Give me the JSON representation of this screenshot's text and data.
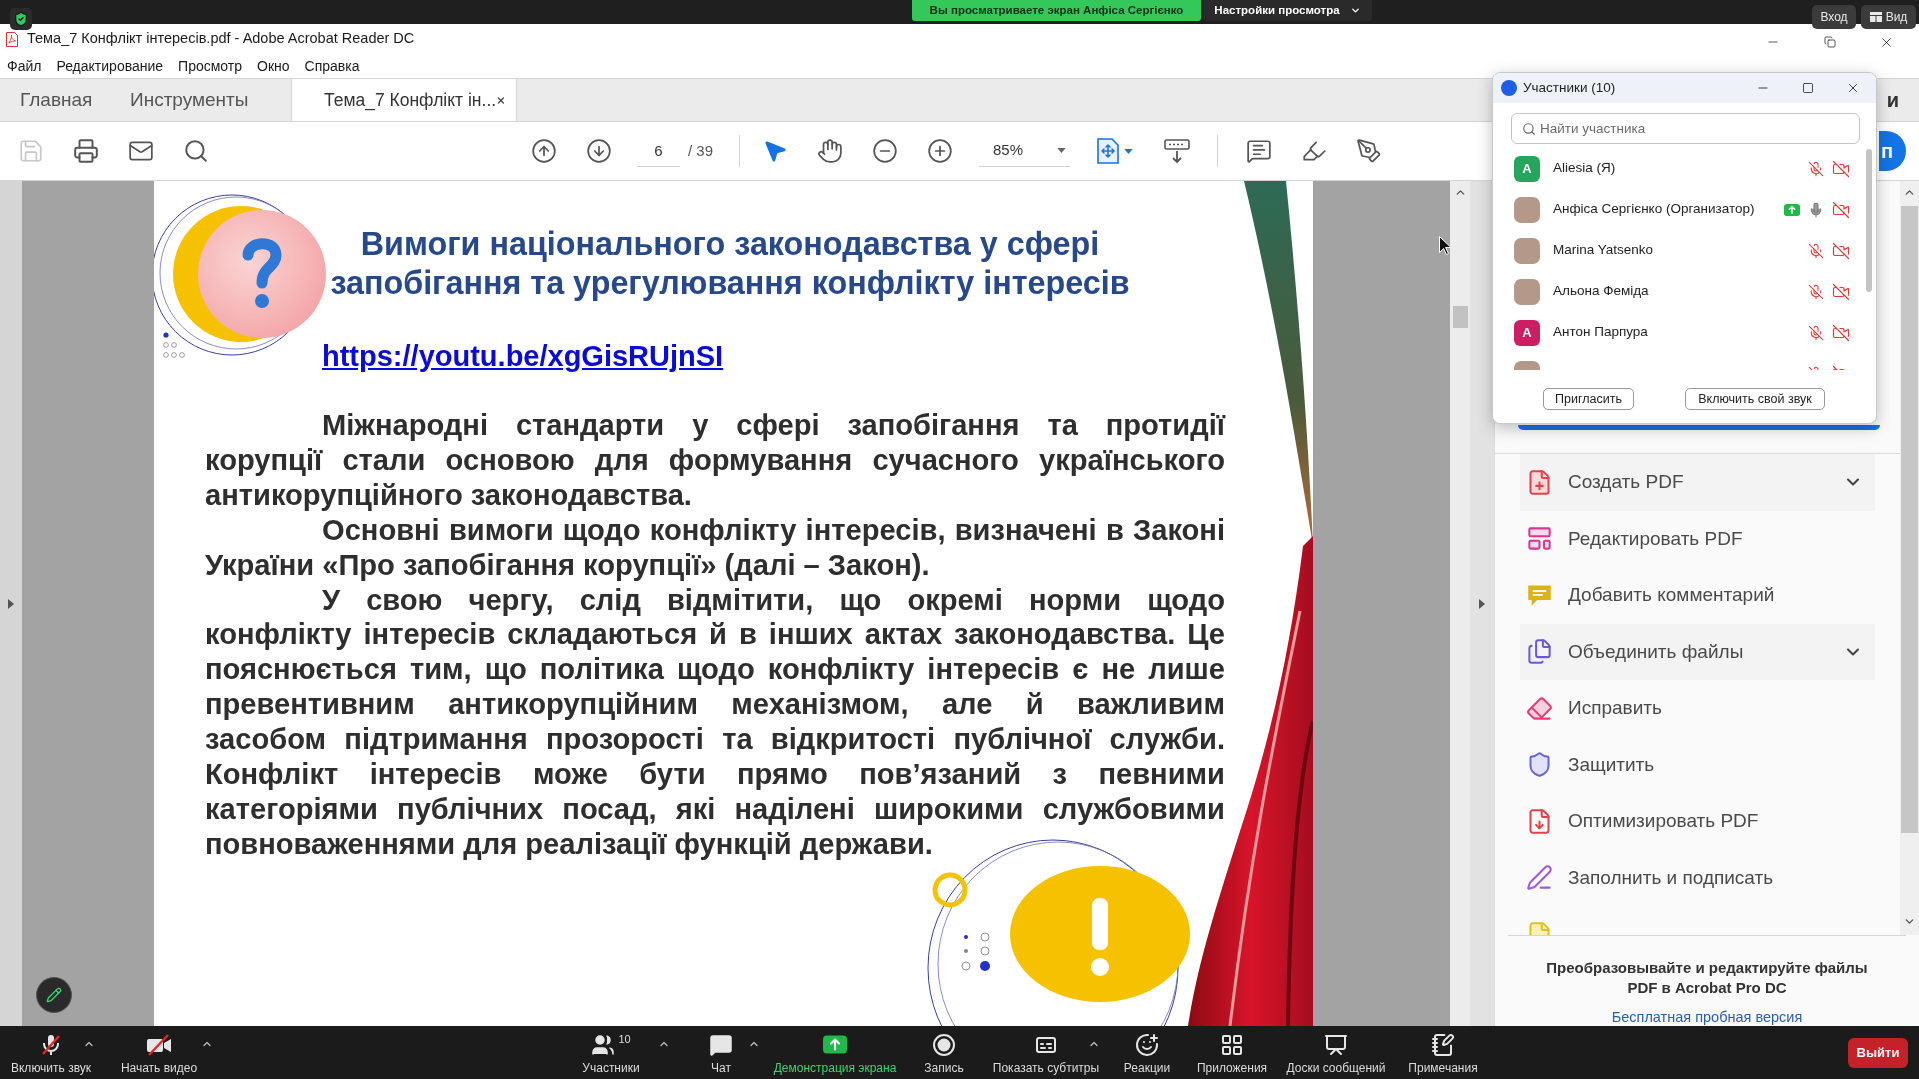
{
  "zoom_top_bar": {
    "viewing_banner": "Вы просматриваете экран Анфіса Сергієнко",
    "view_options": "Настройки просмотра",
    "sign_in": "Вход",
    "view": "Вид"
  },
  "window": {
    "title": "Тема_7 Конфлікт інтересів.pdf - Adobe Acrobat Reader DC"
  },
  "menu": [
    "Файл",
    "Редактирование",
    "Просмотр",
    "Окно",
    "Справка"
  ],
  "tabs": [
    {
      "label": "Главная",
      "selected": false,
      "closable": false
    },
    {
      "label": "Инструменты",
      "selected": false,
      "closable": false
    },
    {
      "label": "Тема_7 Конфлікт ін...",
      "selected": true,
      "closable": true
    }
  ],
  "tab_bar_partial_text": "и",
  "toolbar": {
    "save": {
      "disabled": true
    },
    "page": "6",
    "page_total": "/ 39",
    "cursor_tools": [
      {
        "kind": "select",
        "selected": true
      },
      {
        "kind": "hand",
        "selected": false
      }
    ],
    "zoom": "85%",
    "share_button_partial": "п"
  },
  "document": {
    "title": "Вимоги національного законодавства у сфері запобігання та урегулювання конфлікту інтересів",
    "link": "https://youtu.be/xgGisRUjnSI",
    "paragraphs": [
      "Міжнародні стандарти у сфері запобігання та протидії корупції стали основою для формування сучасного українського антикорупційного законодавства.",
      "Основні вимоги щодо конфлікту інтересів, визначені в Законі України «Про запобігання корупції» (далі – Закон).",
      "У свою чергу, слід відмітити, що окремі норми щодо конфлікту інтересів складаються й в інших актах законодавства. Це пояснюється тим, що політика щодо конфлікту інтересів є не лише превентивним антикорупційним механізмом, але й важливим засобом підтримання прозорості та відкритості публічної служби. Конфлікт інтересів може бути прямо пов’язаний з певними категоріями публічних посад, які наділені широкими службовими повноваженнями для реалізації функцій держави."
    ]
  },
  "tools_panel": {
    "items": [
      {
        "kind": "create",
        "label": "Создать PDF",
        "dropdown": true
      },
      {
        "kind": "edit",
        "label": "Редактировать PDF",
        "dropdown": false
      },
      {
        "kind": "comment",
        "label": "Добавить комментарий",
        "dropdown": false
      },
      {
        "kind": "combine",
        "label": "Объединить файлы",
        "dropdown": true
      },
      {
        "kind": "redact",
        "label": "Исправить",
        "dropdown": false
      },
      {
        "kind": "protect",
        "label": "Защитить",
        "dropdown": false
      },
      {
        "kind": "optimize",
        "label": "Оптимизировать PDF",
        "dropdown": false
      },
      {
        "kind": "fill-sign",
        "label": "Заполнить и подписать",
        "dropdown": false
      },
      {
        "kind": "yellow-file",
        "dropdown": false
      }
    ],
    "promo": {
      "text": "Преобразовывайте и редактируйте файлы PDF в Acrobat Pro DC",
      "link": "Бесплатная пробная версия"
    }
  },
  "participants_window": {
    "title": "Участники (10)",
    "search": {
      "placeholder": "Найти участника"
    },
    "participants": [
      {
        "kind": "letter",
        "initial": "A",
        "color": "#27a55c",
        "name": "Aliesia (Я)",
        "sharing": false,
        "mic_muted": true,
        "video_off": true
      },
      {
        "kind": "photo",
        "name": "Анфіса Сергієнко (Организатор)",
        "sharing": true,
        "mic_muted": false,
        "video_off": true
      },
      {
        "kind": "photo",
        "name": "Marina Yatsenko",
        "sharing": false,
        "mic_muted": true,
        "video_off": true
      },
      {
        "kind": "photo",
        "name": "Альона Феміда",
        "sharing": false,
        "mic_muted": true,
        "video_off": true
      },
      {
        "kind": "letter",
        "initial": "A",
        "color": "#cc1f63",
        "name": "Антон Парпура",
        "sharing": false,
        "mic_muted": true,
        "video_off": true
      },
      {
        "kind": "photo",
        "sharing": false,
        "mic_muted": true,
        "video_off": true
      }
    ],
    "buttons": [
      "Пригласить",
      "Включить свой звук"
    ]
  },
  "meeting_toolbar": {
    "audio": {
      "label": "Включить звук",
      "muted": true
    },
    "video": {
      "label": "Начать видео",
      "off": true
    },
    "controls": [
      {
        "kind": "participants",
        "label": "Участники",
        "count": "10",
        "active": false,
        "caret": true
      },
      {
        "kind": "chat",
        "label": "Чат",
        "active": false,
        "caret": true
      },
      {
        "kind": "share",
        "label": "Демонстрация экрана",
        "active": true,
        "caret": false
      },
      {
        "kind": "record",
        "label": "Запись",
        "active": false,
        "caret": false
      },
      {
        "kind": "captions",
        "label": "Показать субтитры",
        "active": false,
        "caret": true
      },
      {
        "kind": "reactions",
        "label": "Реакции",
        "active": false,
        "caret": false
      },
      {
        "kind": "apps",
        "label": "Приложения",
        "active": false,
        "caret": false
      },
      {
        "kind": "whiteboards",
        "label": "Доски сообщений",
        "active": false,
        "caret": false
      },
      {
        "kind": "notes",
        "label": "Примечания",
        "active": false,
        "caret": false
      }
    ],
    "leave": "Выйти"
  }
}
